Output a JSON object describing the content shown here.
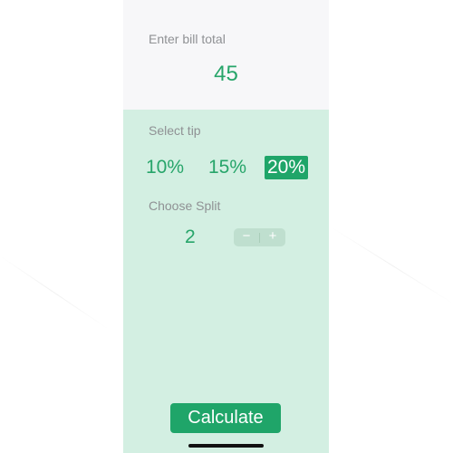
{
  "bill": {
    "label": "Enter bill total",
    "value": "45"
  },
  "tip": {
    "label": "Select tip",
    "options": [
      "10%",
      "15%",
      "20%"
    ],
    "selected": "20%"
  },
  "split": {
    "label": "Choose Split",
    "value": "2",
    "decrement_symbol": "−",
    "increment_symbol": "+"
  },
  "actions": {
    "calculate_label": "Calculate"
  },
  "colors": {
    "accent": "#1fa569",
    "accent_text": "#27a56a",
    "panel_background": "#d3efe2",
    "bill_background": "#f7f7f9",
    "label_text": "#8f9194"
  }
}
